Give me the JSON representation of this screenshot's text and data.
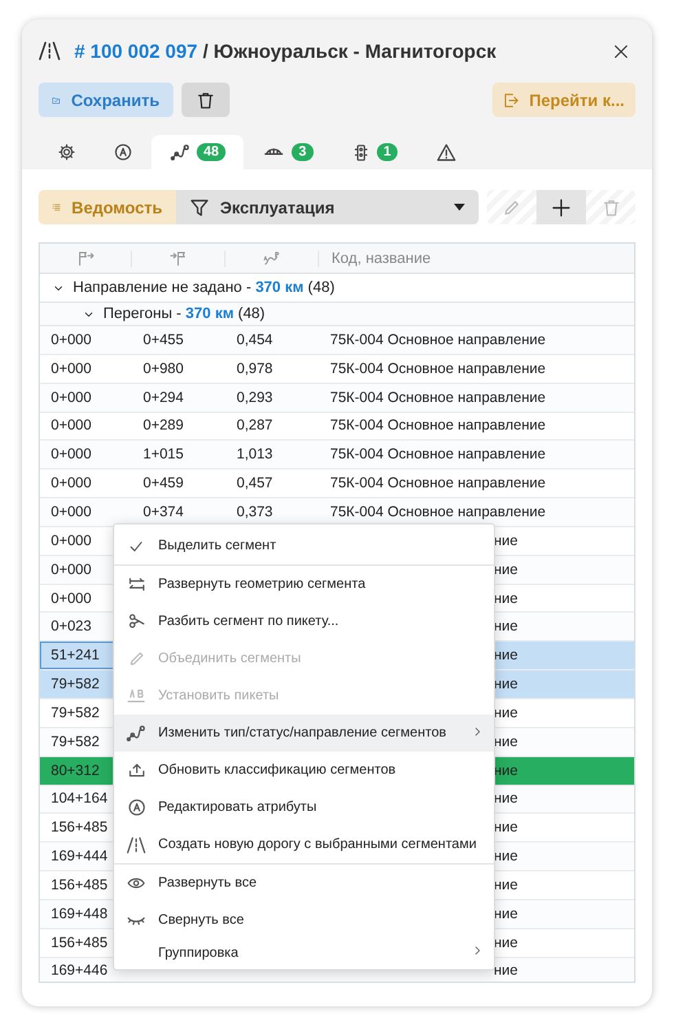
{
  "header": {
    "number": "# 100 002 097",
    "title": "/ Южноуральск - Магнитогорск"
  },
  "actions": {
    "save": "Сохранить",
    "goto": "Перейти к..."
  },
  "tabs": [
    {
      "selected": false
    },
    {
      "selected": false
    },
    {
      "selected": true,
      "badge": "48"
    },
    {
      "selected": false,
      "badge": "3"
    },
    {
      "selected": false,
      "badge": "1"
    },
    {
      "selected": false
    }
  ],
  "toolbar": {
    "view": "Ведомость",
    "filter": "Эксплуатация",
    "edit_disabled": true,
    "delete_disabled": true
  },
  "table": {
    "columns": [
      {
        "kind": "icon"
      },
      {
        "kind": "icon"
      },
      {
        "kind": "icon"
      },
      {
        "kind": "text",
        "label": "Код, название"
      }
    ],
    "groups": [
      {
        "label": "Направление не задано - **370 км** (48)"
      },
      {
        "label": "Перегоны - **370 км** (48)"
      }
    ],
    "rows": [
      {
        "kind": "full",
        "start": "0+000",
        "end": "0+455",
        "length": "0,454",
        "name": "75К-004 Основное направление",
        "selected": false,
        "active": false,
        "focused": false
      },
      {
        "kind": "full",
        "start": "0+000",
        "end": "0+980",
        "length": "0,978",
        "name": "75К-004 Основное направление",
        "selected": false,
        "active": false,
        "focused": false
      },
      {
        "kind": "full",
        "start": "0+000",
        "end": "0+294",
        "length": "0,293",
        "name": "75К-004 Основное направление",
        "selected": false,
        "active": false,
        "focused": false
      },
      {
        "kind": "full",
        "start": "0+000",
        "end": "0+289",
        "length": "0,287",
        "name": "75К-004 Основное направление",
        "selected": false,
        "active": false,
        "focused": false
      },
      {
        "kind": "full",
        "start": "0+000",
        "end": "1+015",
        "length": "1,013",
        "name": "75К-004 Основное направление",
        "selected": false,
        "active": false,
        "focused": false
      },
      {
        "kind": "full",
        "start": "0+000",
        "end": "0+459",
        "length": "0,457",
        "name": "75К-004 Основное направление",
        "selected": false,
        "active": false,
        "focused": false
      },
      {
        "kind": "full",
        "start": "0+000",
        "end": "0+374",
        "length": "0,373",
        "name": "75К-004 Основное направление",
        "selected": false,
        "active": false,
        "focused": false
      },
      {
        "kind": "covered",
        "start": "0+000",
        "name": "ние",
        "selected": false,
        "active": false,
        "focused": false
      },
      {
        "kind": "covered",
        "start": "0+000",
        "name": "ние",
        "selected": false,
        "active": false,
        "focused": false
      },
      {
        "kind": "covered",
        "start": "0+000",
        "name": "ние",
        "selected": false,
        "active": false,
        "focused": false
      },
      {
        "kind": "covered",
        "start": "0+023",
        "name": "ние",
        "selected": false,
        "active": false,
        "focused": false
      },
      {
        "kind": "covered",
        "start": "51+241",
        "name": "ние",
        "selected": true,
        "active": false,
        "focused": true
      },
      {
        "kind": "covered",
        "start": "79+582",
        "name": "ние",
        "selected": true,
        "active": false,
        "focused": false
      },
      {
        "kind": "covered",
        "start": "79+582",
        "name": "ние",
        "selected": false,
        "active": false,
        "focused": false
      },
      {
        "kind": "covered",
        "start": "79+582",
        "name": "ние",
        "selected": false,
        "active": false,
        "focused": false
      },
      {
        "kind": "covered",
        "start": "80+312",
        "name": "ние",
        "selected": false,
        "active": true,
        "focused": false
      },
      {
        "kind": "covered",
        "start": "104+164",
        "name": "ние",
        "selected": false,
        "active": false,
        "focused": false
      },
      {
        "kind": "covered",
        "start": "156+485",
        "name": "ние",
        "selected": false,
        "active": false,
        "focused": false
      },
      {
        "kind": "covered",
        "start": "169+444",
        "name": "ние",
        "selected": false,
        "active": false,
        "focused": false
      },
      {
        "kind": "covered",
        "start": "156+485",
        "name": "ние",
        "selected": false,
        "active": false,
        "focused": false
      },
      {
        "kind": "covered",
        "start": "169+448",
        "name": "ние",
        "selected": false,
        "active": false,
        "focused": false
      },
      {
        "kind": "covered",
        "start": "156+485",
        "name": "ние",
        "selected": false,
        "active": false,
        "focused": false
      },
      {
        "kind": "covered",
        "start": "169+446",
        "name": "ние",
        "selected": false,
        "active": false,
        "focused": false
      }
    ]
  },
  "context_menu": {
    "sections": [
      [
        {
          "label": "Выделить сегмент",
          "disabled": false,
          "highlighted": false,
          "submenu": false
        }
      ],
      [
        {
          "label": "Развернуть геометрию сегмента",
          "disabled": false,
          "highlighted": false,
          "submenu": false
        },
        {
          "label": "Разбить сегмент по пикету...",
          "disabled": false,
          "highlighted": false,
          "submenu": false
        },
        {
          "label": "Объединить сегменты",
          "disabled": true,
          "highlighted": false,
          "submenu": false
        },
        {
          "label": "Установить пикеты",
          "disabled": true,
          "highlighted": false,
          "submenu": false
        },
        {
          "label": "Изменить тип/статус/направление сегментов",
          "disabled": false,
          "highlighted": true,
          "submenu": true
        },
        {
          "label": "Обновить классификацию сегментов",
          "disabled": false,
          "highlighted": false,
          "submenu": false
        },
        {
          "label": "Редактировать атрибуты",
          "disabled": false,
          "highlighted": false,
          "submenu": false
        },
        {
          "label": "Создать новую дорогу с выбранными сегментами",
          "disabled": false,
          "highlighted": false,
          "submenu": false
        }
      ],
      [
        {
          "label": "Развернуть все",
          "disabled": false,
          "highlighted": false,
          "submenu": false
        },
        {
          "label": "Свернуть все",
          "disabled": false,
          "highlighted": false,
          "submenu": false
        },
        {
          "label": "Группировка",
          "disabled": false,
          "highlighted": false,
          "submenu": true
        }
      ]
    ]
  }
}
